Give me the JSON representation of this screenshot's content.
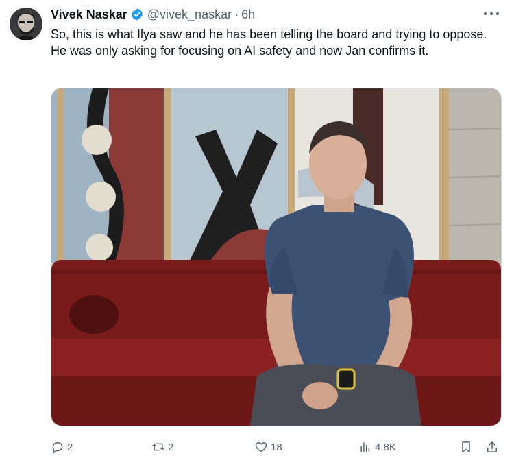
{
  "author": {
    "name": "Vivek Naskar",
    "handle": "@vivek_naskar",
    "separator": "·",
    "time": "6h",
    "verified": true
  },
  "tweet": {
    "text": "So, this is what Ilya saw and he has been telling the board and trying to oppose. He was only asking for focusing on AI safety and now Jan confirms it."
  },
  "icons": {
    "more": "more-horizontal-icon",
    "reply": "reply-icon",
    "repost": "repost-icon",
    "like": "heart-icon",
    "views": "views-chart-icon",
    "bookmark": "bookmark-icon",
    "share": "share-icon"
  },
  "metrics": {
    "replies": "2",
    "reposts": "2",
    "likes": "18",
    "views": "4.8K"
  },
  "colors": {
    "verified_badge": "#1d9bf0",
    "text_primary": "#0f1419",
    "text_secondary": "#536471",
    "sofa": "#7a1b1b"
  }
}
